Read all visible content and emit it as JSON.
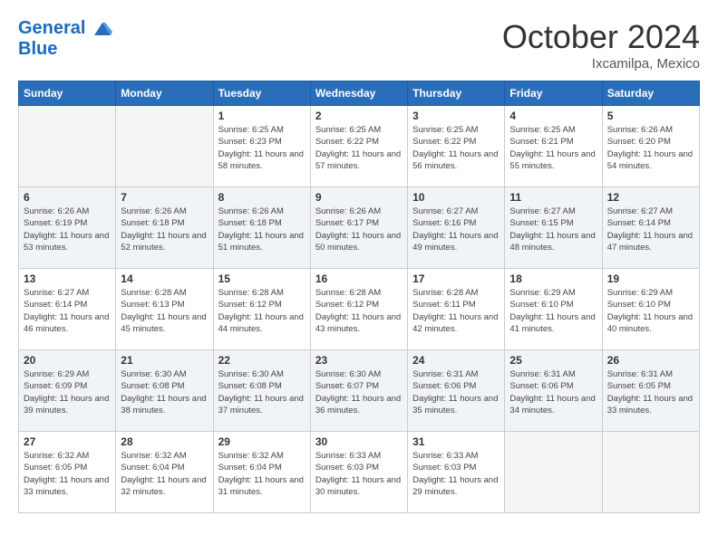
{
  "header": {
    "logo_line1": "General",
    "logo_line2": "Blue",
    "month": "October 2024",
    "location": "Ixcamilpa, Mexico"
  },
  "days_of_week": [
    "Sunday",
    "Monday",
    "Tuesday",
    "Wednesday",
    "Thursday",
    "Friday",
    "Saturday"
  ],
  "weeks": [
    [
      {
        "day": "",
        "empty": true
      },
      {
        "day": "",
        "empty": true
      },
      {
        "day": "1",
        "sunrise": "Sunrise: 6:25 AM",
        "sunset": "Sunset: 6:23 PM",
        "daylight": "Daylight: 11 hours and 58 minutes."
      },
      {
        "day": "2",
        "sunrise": "Sunrise: 6:25 AM",
        "sunset": "Sunset: 6:22 PM",
        "daylight": "Daylight: 11 hours and 57 minutes."
      },
      {
        "day": "3",
        "sunrise": "Sunrise: 6:25 AM",
        "sunset": "Sunset: 6:22 PM",
        "daylight": "Daylight: 11 hours and 56 minutes."
      },
      {
        "day": "4",
        "sunrise": "Sunrise: 6:25 AM",
        "sunset": "Sunset: 6:21 PM",
        "daylight": "Daylight: 11 hours and 55 minutes."
      },
      {
        "day": "5",
        "sunrise": "Sunrise: 6:26 AM",
        "sunset": "Sunset: 6:20 PM",
        "daylight": "Daylight: 11 hours and 54 minutes."
      }
    ],
    [
      {
        "day": "6",
        "sunrise": "Sunrise: 6:26 AM",
        "sunset": "Sunset: 6:19 PM",
        "daylight": "Daylight: 11 hours and 53 minutes."
      },
      {
        "day": "7",
        "sunrise": "Sunrise: 6:26 AM",
        "sunset": "Sunset: 6:18 PM",
        "daylight": "Daylight: 11 hours and 52 minutes."
      },
      {
        "day": "8",
        "sunrise": "Sunrise: 6:26 AM",
        "sunset": "Sunset: 6:18 PM",
        "daylight": "Daylight: 11 hours and 51 minutes."
      },
      {
        "day": "9",
        "sunrise": "Sunrise: 6:26 AM",
        "sunset": "Sunset: 6:17 PM",
        "daylight": "Daylight: 11 hours and 50 minutes."
      },
      {
        "day": "10",
        "sunrise": "Sunrise: 6:27 AM",
        "sunset": "Sunset: 6:16 PM",
        "daylight": "Daylight: 11 hours and 49 minutes."
      },
      {
        "day": "11",
        "sunrise": "Sunrise: 6:27 AM",
        "sunset": "Sunset: 6:15 PM",
        "daylight": "Daylight: 11 hours and 48 minutes."
      },
      {
        "day": "12",
        "sunrise": "Sunrise: 6:27 AM",
        "sunset": "Sunset: 6:14 PM",
        "daylight": "Daylight: 11 hours and 47 minutes."
      }
    ],
    [
      {
        "day": "13",
        "sunrise": "Sunrise: 6:27 AM",
        "sunset": "Sunset: 6:14 PM",
        "daylight": "Daylight: 11 hours and 46 minutes."
      },
      {
        "day": "14",
        "sunrise": "Sunrise: 6:28 AM",
        "sunset": "Sunset: 6:13 PM",
        "daylight": "Daylight: 11 hours and 45 minutes."
      },
      {
        "day": "15",
        "sunrise": "Sunrise: 6:28 AM",
        "sunset": "Sunset: 6:12 PM",
        "daylight": "Daylight: 11 hours and 44 minutes."
      },
      {
        "day": "16",
        "sunrise": "Sunrise: 6:28 AM",
        "sunset": "Sunset: 6:12 PM",
        "daylight": "Daylight: 11 hours and 43 minutes."
      },
      {
        "day": "17",
        "sunrise": "Sunrise: 6:28 AM",
        "sunset": "Sunset: 6:11 PM",
        "daylight": "Daylight: 11 hours and 42 minutes."
      },
      {
        "day": "18",
        "sunrise": "Sunrise: 6:29 AM",
        "sunset": "Sunset: 6:10 PM",
        "daylight": "Daylight: 11 hours and 41 minutes."
      },
      {
        "day": "19",
        "sunrise": "Sunrise: 6:29 AM",
        "sunset": "Sunset: 6:10 PM",
        "daylight": "Daylight: 11 hours and 40 minutes."
      }
    ],
    [
      {
        "day": "20",
        "sunrise": "Sunrise: 6:29 AM",
        "sunset": "Sunset: 6:09 PM",
        "daylight": "Daylight: 11 hours and 39 minutes."
      },
      {
        "day": "21",
        "sunrise": "Sunrise: 6:30 AM",
        "sunset": "Sunset: 6:08 PM",
        "daylight": "Daylight: 11 hours and 38 minutes."
      },
      {
        "day": "22",
        "sunrise": "Sunrise: 6:30 AM",
        "sunset": "Sunset: 6:08 PM",
        "daylight": "Daylight: 11 hours and 37 minutes."
      },
      {
        "day": "23",
        "sunrise": "Sunrise: 6:30 AM",
        "sunset": "Sunset: 6:07 PM",
        "daylight": "Daylight: 11 hours and 36 minutes."
      },
      {
        "day": "24",
        "sunrise": "Sunrise: 6:31 AM",
        "sunset": "Sunset: 6:06 PM",
        "daylight": "Daylight: 11 hours and 35 minutes."
      },
      {
        "day": "25",
        "sunrise": "Sunrise: 6:31 AM",
        "sunset": "Sunset: 6:06 PM",
        "daylight": "Daylight: 11 hours and 34 minutes."
      },
      {
        "day": "26",
        "sunrise": "Sunrise: 6:31 AM",
        "sunset": "Sunset: 6:05 PM",
        "daylight": "Daylight: 11 hours and 33 minutes."
      }
    ],
    [
      {
        "day": "27",
        "sunrise": "Sunrise: 6:32 AM",
        "sunset": "Sunset: 6:05 PM",
        "daylight": "Daylight: 11 hours and 33 minutes."
      },
      {
        "day": "28",
        "sunrise": "Sunrise: 6:32 AM",
        "sunset": "Sunset: 6:04 PM",
        "daylight": "Daylight: 11 hours and 32 minutes."
      },
      {
        "day": "29",
        "sunrise": "Sunrise: 6:32 AM",
        "sunset": "Sunset: 6:04 PM",
        "daylight": "Daylight: 11 hours and 31 minutes."
      },
      {
        "day": "30",
        "sunrise": "Sunrise: 6:33 AM",
        "sunset": "Sunset: 6:03 PM",
        "daylight": "Daylight: 11 hours and 30 minutes."
      },
      {
        "day": "31",
        "sunrise": "Sunrise: 6:33 AM",
        "sunset": "Sunset: 6:03 PM",
        "daylight": "Daylight: 11 hours and 29 minutes."
      },
      {
        "day": "",
        "empty": true
      },
      {
        "day": "",
        "empty": true
      }
    ]
  ]
}
